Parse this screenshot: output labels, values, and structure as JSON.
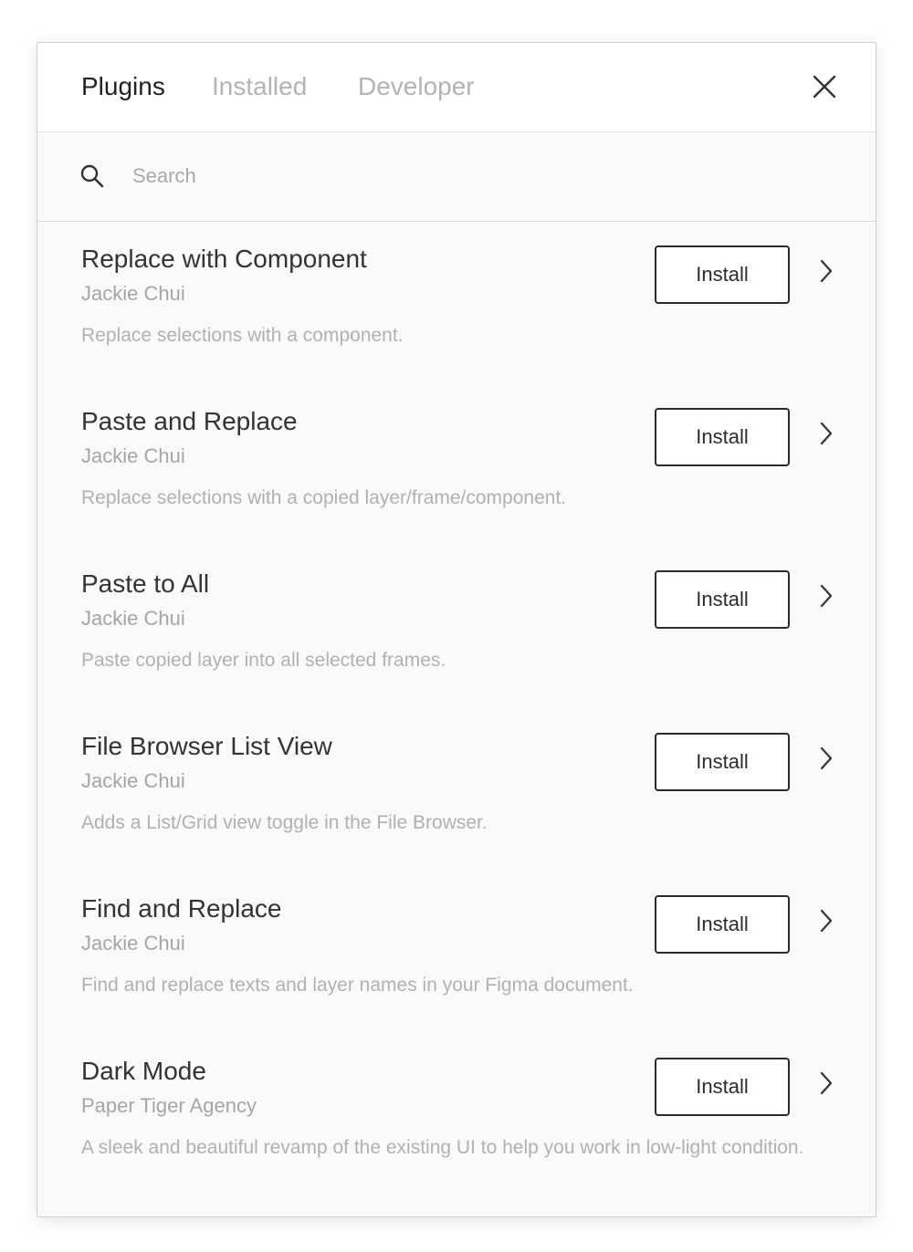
{
  "tabs": [
    {
      "label": "Plugins",
      "active": true
    },
    {
      "label": "Installed",
      "active": false
    },
    {
      "label": "Developer",
      "active": false
    }
  ],
  "close_icon": "close-icon",
  "search": {
    "placeholder": "Search",
    "value": "",
    "icon": "search-icon"
  },
  "plugins": [
    {
      "title": "Replace with Component",
      "author": "Jackie Chui",
      "description": "Replace selections with a component.",
      "button": "Install"
    },
    {
      "title": "Paste and Replace",
      "author": "Jackie Chui",
      "description": "Replace selections with a copied layer/frame/component.",
      "button": "Install"
    },
    {
      "title": "Paste to All",
      "author": "Jackie Chui",
      "description": "Paste copied layer into all selected frames.",
      "button": "Install"
    },
    {
      "title": "File Browser List View",
      "author": "Jackie Chui",
      "description": "Adds a List/Grid view toggle in the File Browser.",
      "button": "Install"
    },
    {
      "title": "Find and Replace",
      "author": "Jackie Chui",
      "description": "Find and replace texts and layer names in your Figma document.",
      "button": "Install"
    },
    {
      "title": "Dark Mode",
      "author": "Paper Tiger Agency",
      "description": "A sleek and beautiful revamp of the existing UI to help you work in low-light condition.",
      "button": "Install"
    }
  ],
  "colors": {
    "text_primary": "#222222",
    "text_muted": "#b3b3b3",
    "button_border": "#2b2b2b"
  }
}
